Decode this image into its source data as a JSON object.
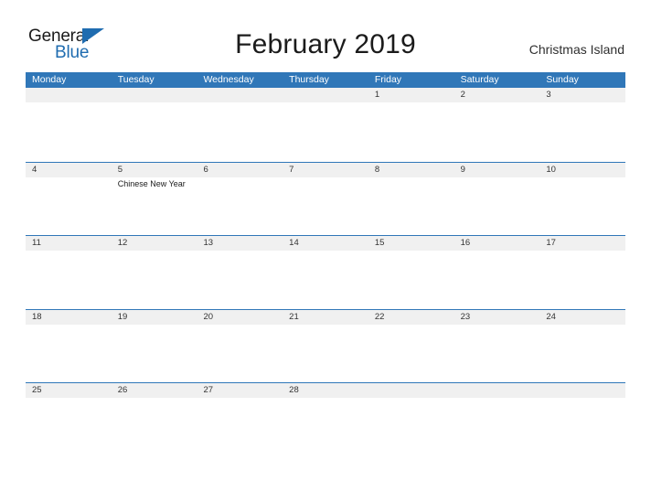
{
  "brand": {
    "line1": "General",
    "line2": "Blue",
    "triangle_color": "#1f6cb0"
  },
  "header": {
    "title": "February 2019",
    "region": "Christmas Island"
  },
  "colors": {
    "header_blue": "#3077b8",
    "band_gray": "#f0f0f0",
    "text_dark": "#1b1b1b"
  },
  "calendar": {
    "weekdays": [
      "Monday",
      "Tuesday",
      "Wednesday",
      "Thursday",
      "Friday",
      "Saturday",
      "Sunday"
    ],
    "weeks": [
      [
        {
          "day": "",
          "event": ""
        },
        {
          "day": "",
          "event": ""
        },
        {
          "day": "",
          "event": ""
        },
        {
          "day": "",
          "event": ""
        },
        {
          "day": "1",
          "event": ""
        },
        {
          "day": "2",
          "event": ""
        },
        {
          "day": "3",
          "event": ""
        }
      ],
      [
        {
          "day": "4",
          "event": ""
        },
        {
          "day": "5",
          "event": "Chinese New Year"
        },
        {
          "day": "6",
          "event": ""
        },
        {
          "day": "7",
          "event": ""
        },
        {
          "day": "8",
          "event": ""
        },
        {
          "day": "9",
          "event": ""
        },
        {
          "day": "10",
          "event": ""
        }
      ],
      [
        {
          "day": "11",
          "event": ""
        },
        {
          "day": "12",
          "event": ""
        },
        {
          "day": "13",
          "event": ""
        },
        {
          "day": "14",
          "event": ""
        },
        {
          "day": "15",
          "event": ""
        },
        {
          "day": "16",
          "event": ""
        },
        {
          "day": "17",
          "event": ""
        }
      ],
      [
        {
          "day": "18",
          "event": ""
        },
        {
          "day": "19",
          "event": ""
        },
        {
          "day": "20",
          "event": ""
        },
        {
          "day": "21",
          "event": ""
        },
        {
          "day": "22",
          "event": ""
        },
        {
          "day": "23",
          "event": ""
        },
        {
          "day": "24",
          "event": ""
        }
      ],
      [
        {
          "day": "25",
          "event": ""
        },
        {
          "day": "26",
          "event": ""
        },
        {
          "day": "27",
          "event": ""
        },
        {
          "day": "28",
          "event": ""
        },
        {
          "day": "",
          "event": ""
        },
        {
          "day": "",
          "event": ""
        },
        {
          "day": "",
          "event": ""
        }
      ]
    ]
  }
}
